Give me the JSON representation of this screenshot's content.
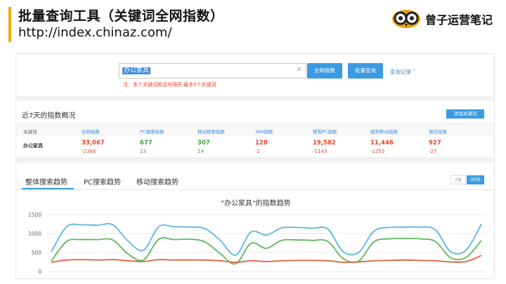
{
  "slide": {
    "title": "批量查询工具（关键词全网指数）",
    "url": "http://index.chinaz.com/"
  },
  "logo": {
    "text": "曾子运营笔记"
  },
  "search": {
    "value": "办公家具",
    "clear": "×",
    "btn_all": "全网指数",
    "btn_batch": "批量查询",
    "history": "查询记录 ˅",
    "note": "注：多个关键词用逗号隔开,最多5个关键词"
  },
  "overview": {
    "title": "近7天的指数概况",
    "add_button": "添加关键词",
    "headers": [
      "关键词",
      "全网指数",
      "PC搜索指数",
      "移动搜索指数",
      "360指数",
      "搜狗PC指数",
      "搜狗移动指数",
      "微信指数"
    ],
    "keyword": "办公家具",
    "values": [
      "33,067",
      "677",
      "307",
      "128",
      "19,582",
      "11,446",
      "927"
    ],
    "diffs": [
      "-2388",
      "23",
      "14",
      "-2",
      "-1143",
      "-1253",
      "-27"
    ]
  },
  "trend": {
    "tabs": [
      "整体搜索趋势",
      "PC搜索趋势",
      "移动搜索趋势"
    ],
    "range_7": "7天",
    "range_30": "30天"
  },
  "colors": {
    "accent": "#3b9be0",
    "blue_line": "#5bb6e6",
    "green_line": "#5cb85c",
    "red_line": "#e0603a"
  },
  "chart_data": {
    "type": "line",
    "title": "\"办公家具\"的指数趋势",
    "yticks": [
      "1500",
      "1000",
      "500",
      "0"
    ],
    "ylim": [
      0,
      1500
    ],
    "grid": true,
    "series": [
      {
        "color": "#5bb6e6",
        "values": [
          520,
          1180,
          1230,
          1220,
          1230,
          800,
          560,
          1180,
          1180,
          1170,
          1130,
          820,
          430,
          1040,
          960,
          1150,
          1160,
          1140,
          1120,
          520,
          500,
          1060,
          1160,
          1170,
          1170,
          1100,
          520,
          560,
          1250
        ]
      },
      {
        "color": "#5cb85c",
        "values": [
          270,
          790,
          840,
          840,
          830,
          460,
          300,
          850,
          840,
          850,
          780,
          470,
          200,
          740,
          610,
          820,
          830,
          820,
          790,
          340,
          270,
          780,
          860,
          870,
          860,
          790,
          360,
          370,
          820
        ]
      },
      {
        "color": "#e0603a",
        "values": [
          240,
          300,
          310,
          300,
          310,
          280,
          260,
          310,
          300,
          300,
          300,
          280,
          240,
          280,
          260,
          280,
          290,
          290,
          280,
          240,
          250,
          280,
          290,
          300,
          290,
          280,
          250,
          260,
          420
        ]
      }
    ]
  }
}
